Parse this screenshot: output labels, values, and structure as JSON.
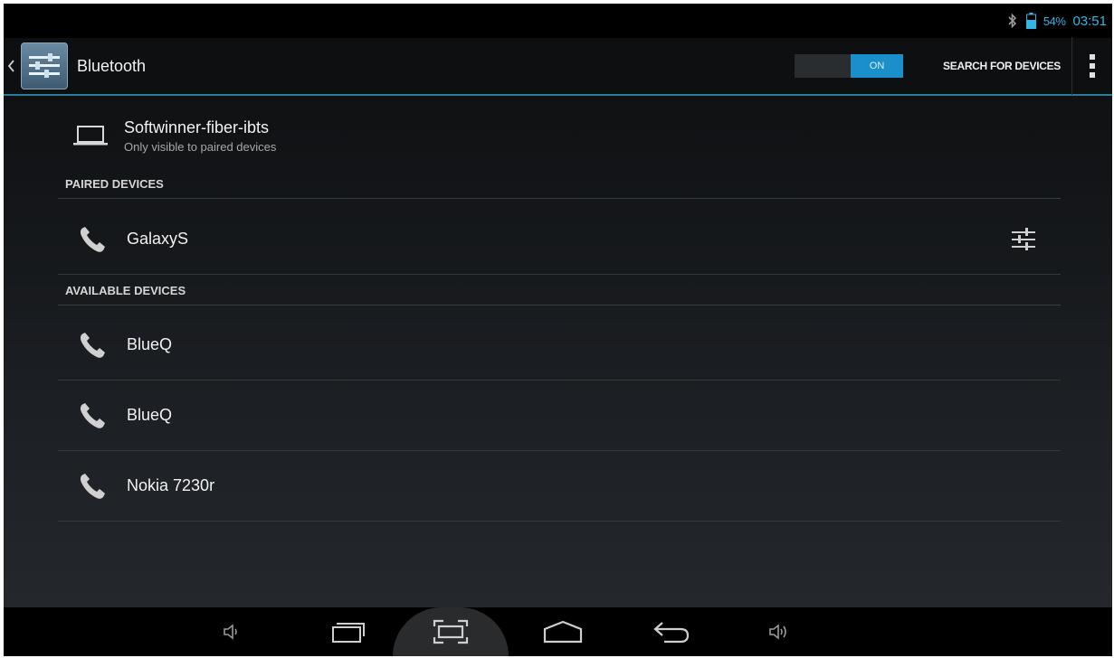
{
  "status_bar": {
    "battery_percent": "54%",
    "time": "03:51",
    "icons": [
      "bluetooth-icon",
      "battery-icon"
    ]
  },
  "action_bar": {
    "title": "Bluetooth",
    "toggle_label": "ON",
    "toggle_state": "on",
    "search_label": "SEARCH FOR DEVICES",
    "accent_color": "#33b5e5"
  },
  "this_device": {
    "name": "Softwinner-fiber-ibts",
    "visibility": "Only visible to paired devices",
    "icon": "laptop-icon"
  },
  "paired": {
    "header": "PAIRED DEVICES",
    "devices": [
      {
        "name": "GalaxyS",
        "icon": "phone-icon"
      }
    ]
  },
  "available": {
    "header": "AVAILABLE DEVICES",
    "devices": [
      {
        "name": "BlueQ",
        "icon": "phone-icon"
      },
      {
        "name": "BlueQ",
        "icon": "phone-icon"
      },
      {
        "name": "Nokia 7230r",
        "icon": "phone-icon"
      }
    ]
  },
  "nav_bar": {
    "items": [
      "volume-down-icon",
      "recent-apps-icon",
      "screenshot-icon",
      "home-icon",
      "back-icon",
      "volume-up-icon"
    ],
    "active": "screenshot-icon"
  }
}
